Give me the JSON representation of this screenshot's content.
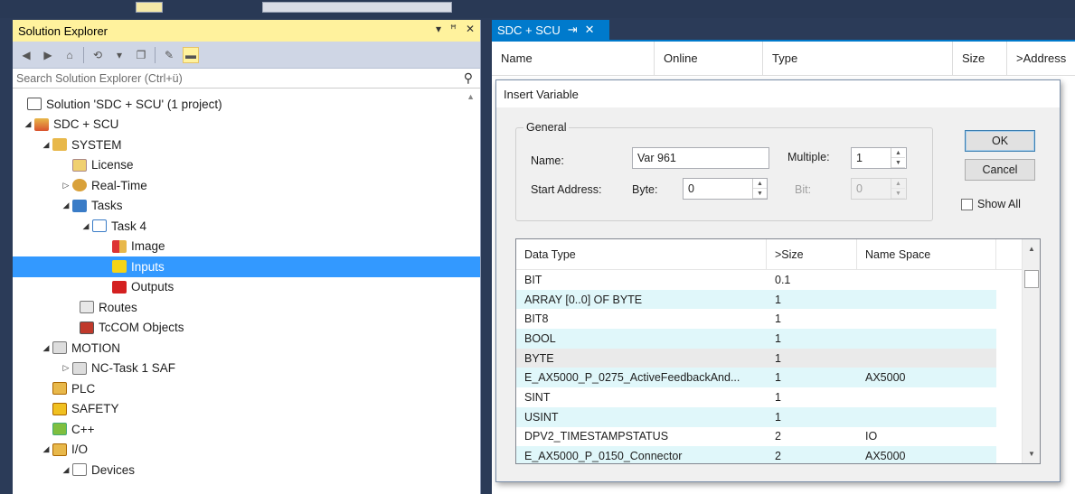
{
  "solution_explorer": {
    "title": "Solution Explorer",
    "header_controls": [
      "▾",
      "ꟸ",
      "✕"
    ],
    "search_placeholder": "Search Solution Explorer (Ctrl+ü)",
    "tree": [
      {
        "label": "Solution 'SDC + SCU' (1 project)",
        "icon": "solution-icon"
      },
      {
        "label": "SDC + SCU",
        "icon": "project-icon"
      },
      {
        "label": "SYSTEM",
        "icon": "system-icon"
      },
      {
        "label": "License",
        "icon": "license-icon"
      },
      {
        "label": "Real-Time",
        "icon": "realtime-icon"
      },
      {
        "label": "Tasks",
        "icon": "tasks-icon"
      },
      {
        "label": "Task 4",
        "icon": "task-icon"
      },
      {
        "label": "Image",
        "icon": "image-icon"
      },
      {
        "label": "Inputs",
        "icon": "inputs-icon"
      },
      {
        "label": "Outputs",
        "icon": "outputs-icon"
      },
      {
        "label": "Routes",
        "icon": "routes-icon"
      },
      {
        "label": "TcCOM Objects",
        "icon": "tccom-icon"
      },
      {
        "label": "MOTION",
        "icon": "motion-icon"
      },
      {
        "label": "NC-Task 1 SAF",
        "icon": "nctask-icon"
      },
      {
        "label": "PLC",
        "icon": "plc-icon"
      },
      {
        "label": "SAFETY",
        "icon": "safety-icon"
      },
      {
        "label": "C++",
        "icon": "cpp-icon"
      },
      {
        "label": "I/O",
        "icon": "io-icon"
      },
      {
        "label": "Devices",
        "icon": "devices-icon"
      }
    ]
  },
  "editor": {
    "tab_label": "SDC + SCU",
    "pin_glyph": "⇥",
    "close_glyph": "✕",
    "columns": [
      "Name",
      "Online",
      "Type",
      "Size",
      ">Address"
    ]
  },
  "dialog": {
    "title": "Insert Variable",
    "group_label": "General",
    "name_label": "Name:",
    "name_value": "Var 961",
    "multiple_label": "Multiple:",
    "multiple_value": "1",
    "start_address_label": "Start Address:",
    "byte_label": "Byte:",
    "byte_value": "0",
    "bit_label": "Bit:",
    "bit_value": "0",
    "ok_label": "OK",
    "cancel_label": "Cancel",
    "show_all_label": "Show All",
    "show_all_checked": false,
    "list_columns": [
      "Data Type",
      ">Size",
      "Name Space"
    ],
    "rows": [
      [
        "BIT",
        "0.1",
        ""
      ],
      [
        "ARRAY [0..0] OF BYTE",
        "1",
        ""
      ],
      [
        "BIT8",
        "1",
        ""
      ],
      [
        "BOOL",
        "1",
        ""
      ],
      [
        "BYTE",
        "1",
        ""
      ],
      [
        "E_AX5000_P_0275_ActiveFeedbackAnd...",
        "1",
        "AX5000"
      ],
      [
        "SINT",
        "1",
        ""
      ],
      [
        "USINT",
        "1",
        ""
      ],
      [
        "DPV2_TIMESTAMPSTATUS",
        "2",
        "IO"
      ],
      [
        "E_AX5000_P_0150_Connector",
        "2",
        "AX5000"
      ]
    ]
  }
}
